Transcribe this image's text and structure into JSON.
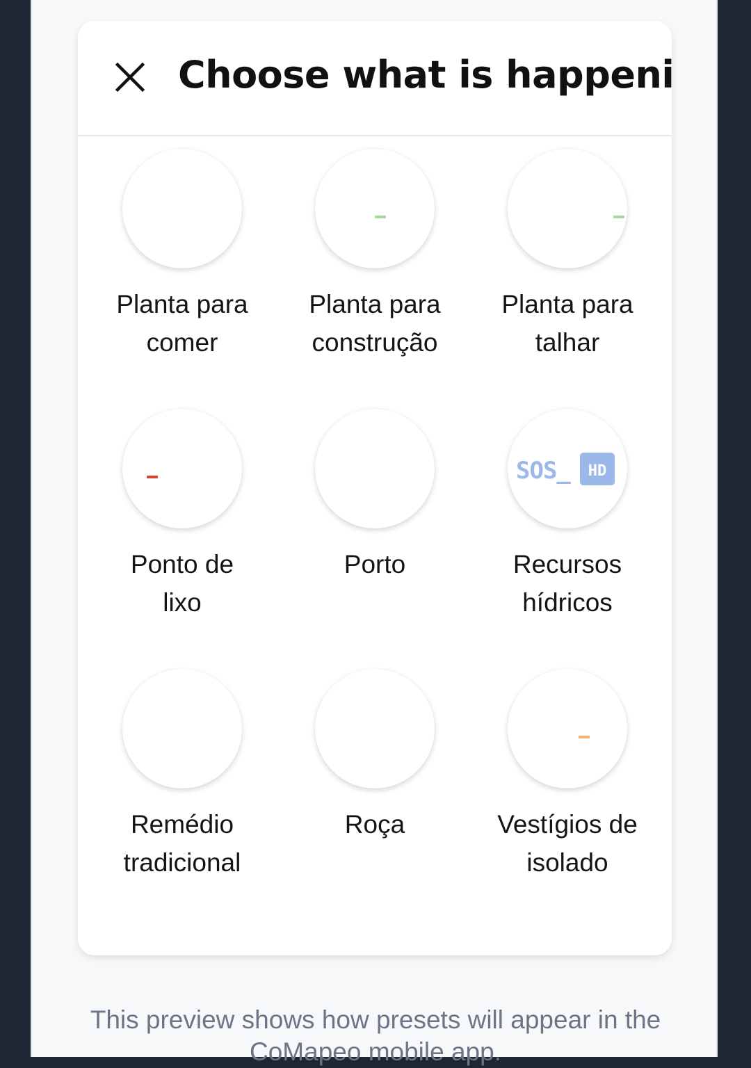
{
  "dialog": {
    "title": "Choose what is happening",
    "close_icon": "close-icon"
  },
  "presets": [
    {
      "line1": "Planta para",
      "line2": "comer",
      "icon": "empty"
    },
    {
      "line1": "Planta para",
      "line2": "construção",
      "icon": "green-dash",
      "color": "#a8d5a0"
    },
    {
      "line1": "Planta para",
      "line2": "talhar",
      "icon": "green-dash",
      "color": "#a8d5a0"
    },
    {
      "line1": "Ponto de",
      "line2": "lixo",
      "icon": "red-dash",
      "color": "#d0472f"
    },
    {
      "line1": "Porto",
      "line2": "",
      "icon": "empty"
    },
    {
      "line1": "Recursos",
      "line2": "hídricos",
      "icon": "sos-hd-logo",
      "logo_text": "SOS_",
      "badge_text": "HD",
      "color": "#9bb8e8"
    },
    {
      "line1": "Remédio",
      "line2": "tradicional",
      "icon": "empty"
    },
    {
      "line1": "Roça",
      "line2": "",
      "icon": "empty"
    },
    {
      "line1": "Vestígios de",
      "line2": "isolado",
      "icon": "orange-dash",
      "color": "#f2b37a"
    }
  ],
  "footer": {
    "line1": "This preview shows how presets will appear in the",
    "line2": "CoMapeo mobile app."
  }
}
